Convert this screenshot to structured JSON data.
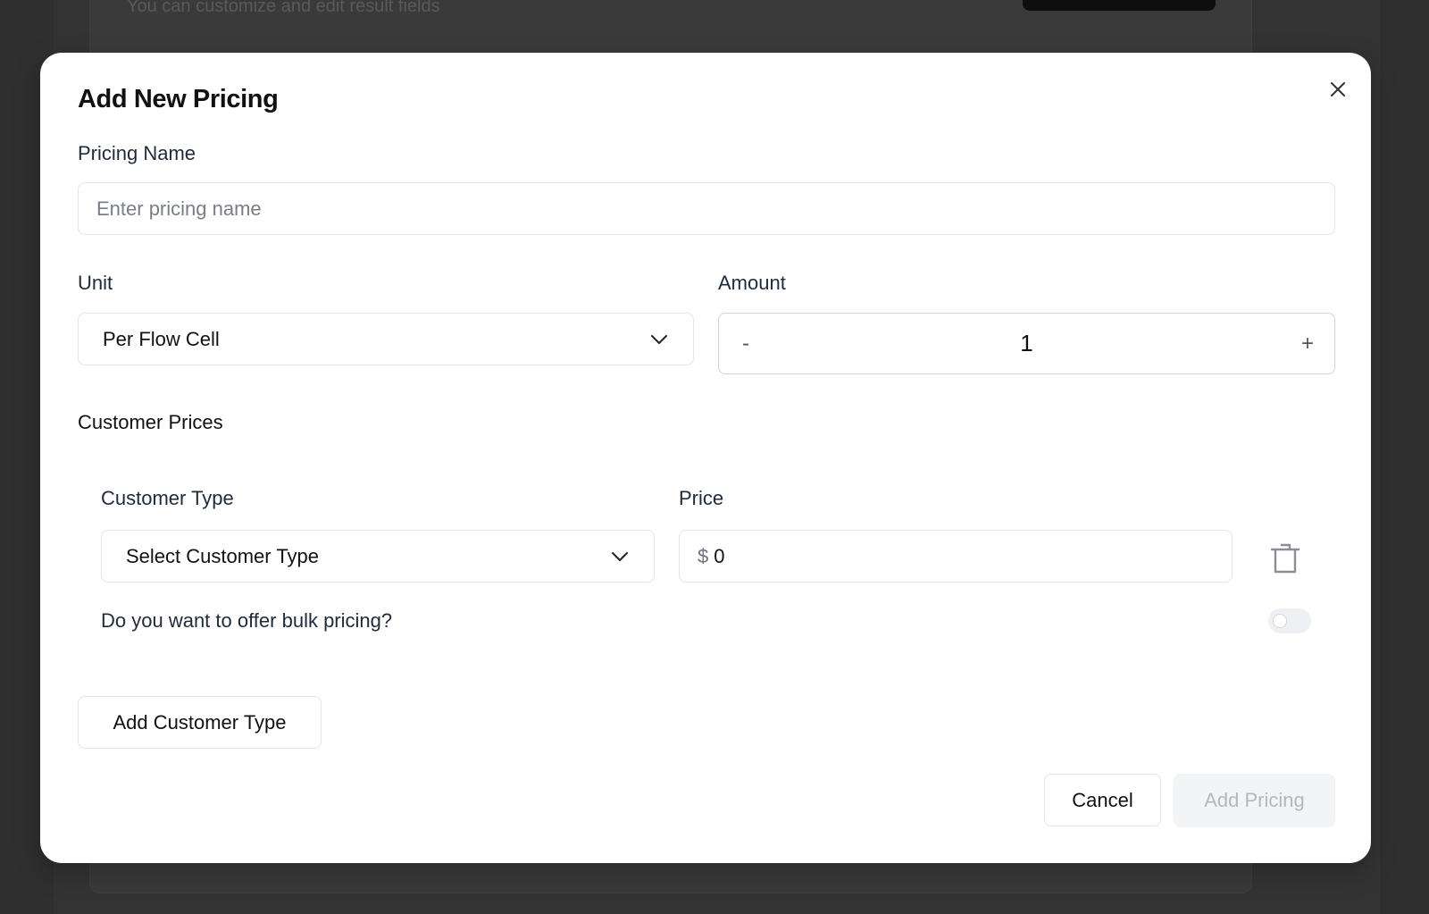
{
  "background": {
    "subtitle": "You can customize and edit result fields"
  },
  "modal": {
    "title": "Add New Pricing",
    "close_icon": "close-icon",
    "pricing_name": {
      "label": "Pricing Name",
      "placeholder": "Enter pricing name",
      "value": ""
    },
    "unit": {
      "label": "Unit",
      "selected": "Per Flow Cell"
    },
    "amount": {
      "label": "Amount",
      "decrement": "-",
      "value": "1",
      "increment": "+"
    },
    "customer_prices": {
      "title": "Customer Prices",
      "rows": [
        {
          "customer_type_label": "Customer Type",
          "customer_type_value": "Select Customer Type",
          "price_label": "Price",
          "currency": "$",
          "price_value": "0",
          "bulk_question": "Do you want to offer bulk pricing?",
          "bulk_enabled": false
        }
      ],
      "add_button": "Add Customer Type"
    },
    "footer": {
      "cancel": "Cancel",
      "submit": "Add Pricing"
    }
  }
}
